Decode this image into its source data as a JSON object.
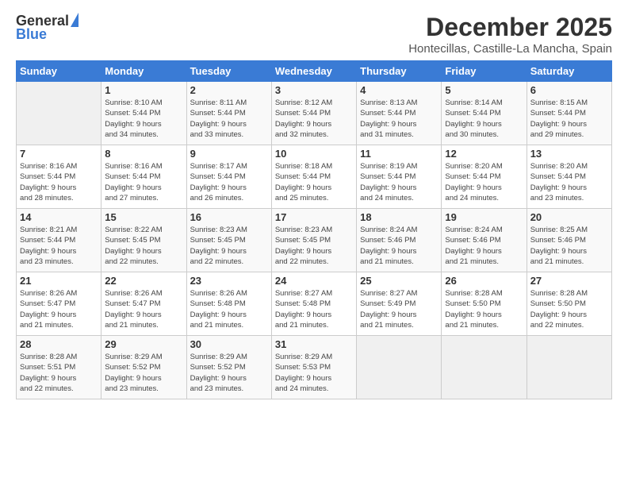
{
  "header": {
    "logo_line1": "General",
    "logo_line2": "Blue",
    "title": "December 2025",
    "subtitle": "Hontecillas, Castille-La Mancha, Spain"
  },
  "days_of_week": [
    "Sunday",
    "Monday",
    "Tuesday",
    "Wednesday",
    "Thursday",
    "Friday",
    "Saturday"
  ],
  "weeks": [
    [
      {
        "num": "",
        "detail": ""
      },
      {
        "num": "1",
        "detail": "Sunrise: 8:10 AM\nSunset: 5:44 PM\nDaylight: 9 hours\nand 34 minutes."
      },
      {
        "num": "2",
        "detail": "Sunrise: 8:11 AM\nSunset: 5:44 PM\nDaylight: 9 hours\nand 33 minutes."
      },
      {
        "num": "3",
        "detail": "Sunrise: 8:12 AM\nSunset: 5:44 PM\nDaylight: 9 hours\nand 32 minutes."
      },
      {
        "num": "4",
        "detail": "Sunrise: 8:13 AM\nSunset: 5:44 PM\nDaylight: 9 hours\nand 31 minutes."
      },
      {
        "num": "5",
        "detail": "Sunrise: 8:14 AM\nSunset: 5:44 PM\nDaylight: 9 hours\nand 30 minutes."
      },
      {
        "num": "6",
        "detail": "Sunrise: 8:15 AM\nSunset: 5:44 PM\nDaylight: 9 hours\nand 29 minutes."
      }
    ],
    [
      {
        "num": "7",
        "detail": "Sunrise: 8:16 AM\nSunset: 5:44 PM\nDaylight: 9 hours\nand 28 minutes."
      },
      {
        "num": "8",
        "detail": "Sunrise: 8:16 AM\nSunset: 5:44 PM\nDaylight: 9 hours\nand 27 minutes."
      },
      {
        "num": "9",
        "detail": "Sunrise: 8:17 AM\nSunset: 5:44 PM\nDaylight: 9 hours\nand 26 minutes."
      },
      {
        "num": "10",
        "detail": "Sunrise: 8:18 AM\nSunset: 5:44 PM\nDaylight: 9 hours\nand 25 minutes."
      },
      {
        "num": "11",
        "detail": "Sunrise: 8:19 AM\nSunset: 5:44 PM\nDaylight: 9 hours\nand 24 minutes."
      },
      {
        "num": "12",
        "detail": "Sunrise: 8:20 AM\nSunset: 5:44 PM\nDaylight: 9 hours\nand 24 minutes."
      },
      {
        "num": "13",
        "detail": "Sunrise: 8:20 AM\nSunset: 5:44 PM\nDaylight: 9 hours\nand 23 minutes."
      }
    ],
    [
      {
        "num": "14",
        "detail": "Sunrise: 8:21 AM\nSunset: 5:44 PM\nDaylight: 9 hours\nand 23 minutes."
      },
      {
        "num": "15",
        "detail": "Sunrise: 8:22 AM\nSunset: 5:45 PM\nDaylight: 9 hours\nand 22 minutes."
      },
      {
        "num": "16",
        "detail": "Sunrise: 8:23 AM\nSunset: 5:45 PM\nDaylight: 9 hours\nand 22 minutes."
      },
      {
        "num": "17",
        "detail": "Sunrise: 8:23 AM\nSunset: 5:45 PM\nDaylight: 9 hours\nand 22 minutes."
      },
      {
        "num": "18",
        "detail": "Sunrise: 8:24 AM\nSunset: 5:46 PM\nDaylight: 9 hours\nand 21 minutes."
      },
      {
        "num": "19",
        "detail": "Sunrise: 8:24 AM\nSunset: 5:46 PM\nDaylight: 9 hours\nand 21 minutes."
      },
      {
        "num": "20",
        "detail": "Sunrise: 8:25 AM\nSunset: 5:46 PM\nDaylight: 9 hours\nand 21 minutes."
      }
    ],
    [
      {
        "num": "21",
        "detail": "Sunrise: 8:26 AM\nSunset: 5:47 PM\nDaylight: 9 hours\nand 21 minutes."
      },
      {
        "num": "22",
        "detail": "Sunrise: 8:26 AM\nSunset: 5:47 PM\nDaylight: 9 hours\nand 21 minutes."
      },
      {
        "num": "23",
        "detail": "Sunrise: 8:26 AM\nSunset: 5:48 PM\nDaylight: 9 hours\nand 21 minutes."
      },
      {
        "num": "24",
        "detail": "Sunrise: 8:27 AM\nSunset: 5:48 PM\nDaylight: 9 hours\nand 21 minutes."
      },
      {
        "num": "25",
        "detail": "Sunrise: 8:27 AM\nSunset: 5:49 PM\nDaylight: 9 hours\nand 21 minutes."
      },
      {
        "num": "26",
        "detail": "Sunrise: 8:28 AM\nSunset: 5:50 PM\nDaylight: 9 hours\nand 21 minutes."
      },
      {
        "num": "27",
        "detail": "Sunrise: 8:28 AM\nSunset: 5:50 PM\nDaylight: 9 hours\nand 22 minutes."
      }
    ],
    [
      {
        "num": "28",
        "detail": "Sunrise: 8:28 AM\nSunset: 5:51 PM\nDaylight: 9 hours\nand 22 minutes."
      },
      {
        "num": "29",
        "detail": "Sunrise: 8:29 AM\nSunset: 5:52 PM\nDaylight: 9 hours\nand 23 minutes."
      },
      {
        "num": "30",
        "detail": "Sunrise: 8:29 AM\nSunset: 5:52 PM\nDaylight: 9 hours\nand 23 minutes."
      },
      {
        "num": "31",
        "detail": "Sunrise: 8:29 AM\nSunset: 5:53 PM\nDaylight: 9 hours\nand 24 minutes."
      },
      {
        "num": "",
        "detail": ""
      },
      {
        "num": "",
        "detail": ""
      },
      {
        "num": "",
        "detail": ""
      }
    ]
  ]
}
